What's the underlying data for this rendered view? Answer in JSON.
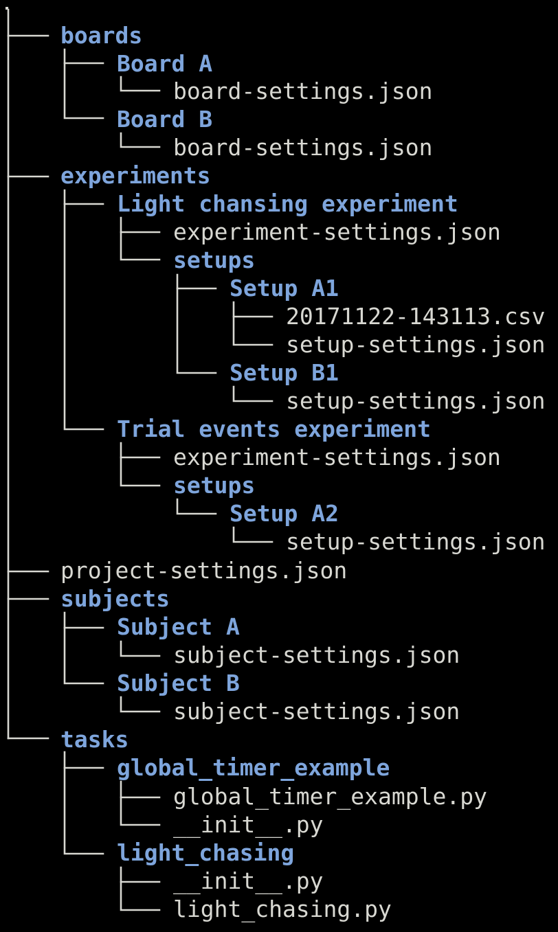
{
  "tree": {
    "root": ".",
    "boards": {
      "name": "boards",
      "board_a": {
        "name": "Board A",
        "settings": "board-settings.json"
      },
      "board_b": {
        "name": "Board B",
        "settings": "board-settings.json"
      }
    },
    "experiments": {
      "name": "experiments",
      "light": {
        "name": "Light chansing experiment",
        "settings": "experiment-settings.json",
        "setups": "setups",
        "setup_a1": {
          "name": "Setup A1",
          "csv": "20171122-143113.csv",
          "settings": "setup-settings.json"
        },
        "setup_b1": {
          "name": "Setup B1",
          "settings": "setup-settings.json"
        }
      },
      "trial": {
        "name": "Trial events experiment",
        "settings": "experiment-settings.json",
        "setups": "setups",
        "setup_a2": {
          "name": "Setup A2",
          "settings": "setup-settings.json"
        }
      }
    },
    "project_settings": "project-settings.json",
    "subjects": {
      "name": "subjects",
      "subject_a": {
        "name": "Subject A",
        "settings": "subject-settings.json"
      },
      "subject_b": {
        "name": "Subject B",
        "settings": "subject-settings.json"
      }
    },
    "tasks": {
      "name": "tasks",
      "global_timer": {
        "name": "global_timer_example",
        "script": "global_timer_example.py",
        "init": "__init__.py"
      },
      "light_chasing": {
        "name": "light_chasing",
        "init": "__init__.py",
        "script": "light_chasing.py"
      }
    }
  },
  "colors": {
    "background": "#000000",
    "directory": "#7ea5dc",
    "file": "#d8d8d2",
    "connector": "#d8d8d2"
  }
}
